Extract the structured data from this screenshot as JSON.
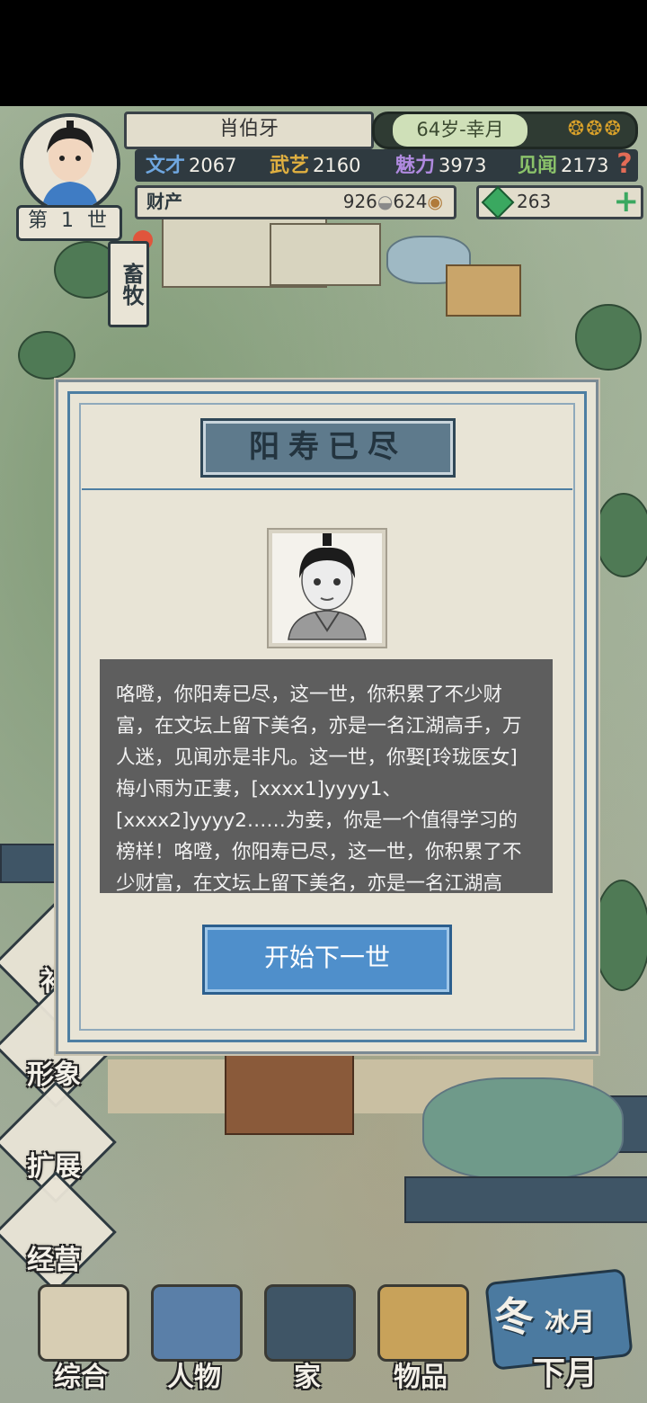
{
  "hud": {
    "name": "肖伯牙",
    "generation": "第 1 世",
    "age_month": "64岁-幸月",
    "stats": [
      {
        "key": "文才",
        "value": "2067",
        "color": "#6fa7e0"
      },
      {
        "key": "武艺",
        "value": "2160",
        "color": "#e0b040"
      },
      {
        "key": "魅力",
        "value": "3973",
        "color": "#b08ae0"
      },
      {
        "key": "见闻",
        "value": "2173",
        "color": "#8ac26a"
      }
    ],
    "assets_label": "财产",
    "silver": "926",
    "copper": "624",
    "gems": "263",
    "area_tag": "畜牧"
  },
  "side_menu": [
    {
      "label": "补",
      "name": "supplement"
    },
    {
      "label": "形象",
      "name": "appearance"
    },
    {
      "label": "扩展",
      "name": "expand"
    },
    {
      "label": "经营",
      "name": "business"
    }
  ],
  "bottom_menu": [
    {
      "label": "综合"
    },
    {
      "label": "人物"
    },
    {
      "label": "家"
    },
    {
      "label": "物品"
    }
  ],
  "season": {
    "season_char": "冬",
    "month": "冰月",
    "next": "下月"
  },
  "modal": {
    "title": "阳寿已尽",
    "story": "咯噔，你阳寿已尽，这一世，你积累了不少财富，在文坛上留下美名，亦是一名江湖高手，万人迷，见闻亦是非凡。这一世，你娶[玲珑医女]梅小雨为正妻，[xxxx1]yyyy1、[xxxx2]yyyy2……为妾，你是一个值得学习的榜样！咯噔，你阳寿已尽，这一世，你积累了不少财富，在文坛上留下美名，亦是一名江湖高手，万人迷，见闻亦是非凡。这一世，你娶[玲",
    "button": "开始下一世"
  },
  "colors": {
    "modal_bg": "#e8e4d6",
    "button": "#4f8fcb",
    "story_bg": "#5e5e5e"
  }
}
